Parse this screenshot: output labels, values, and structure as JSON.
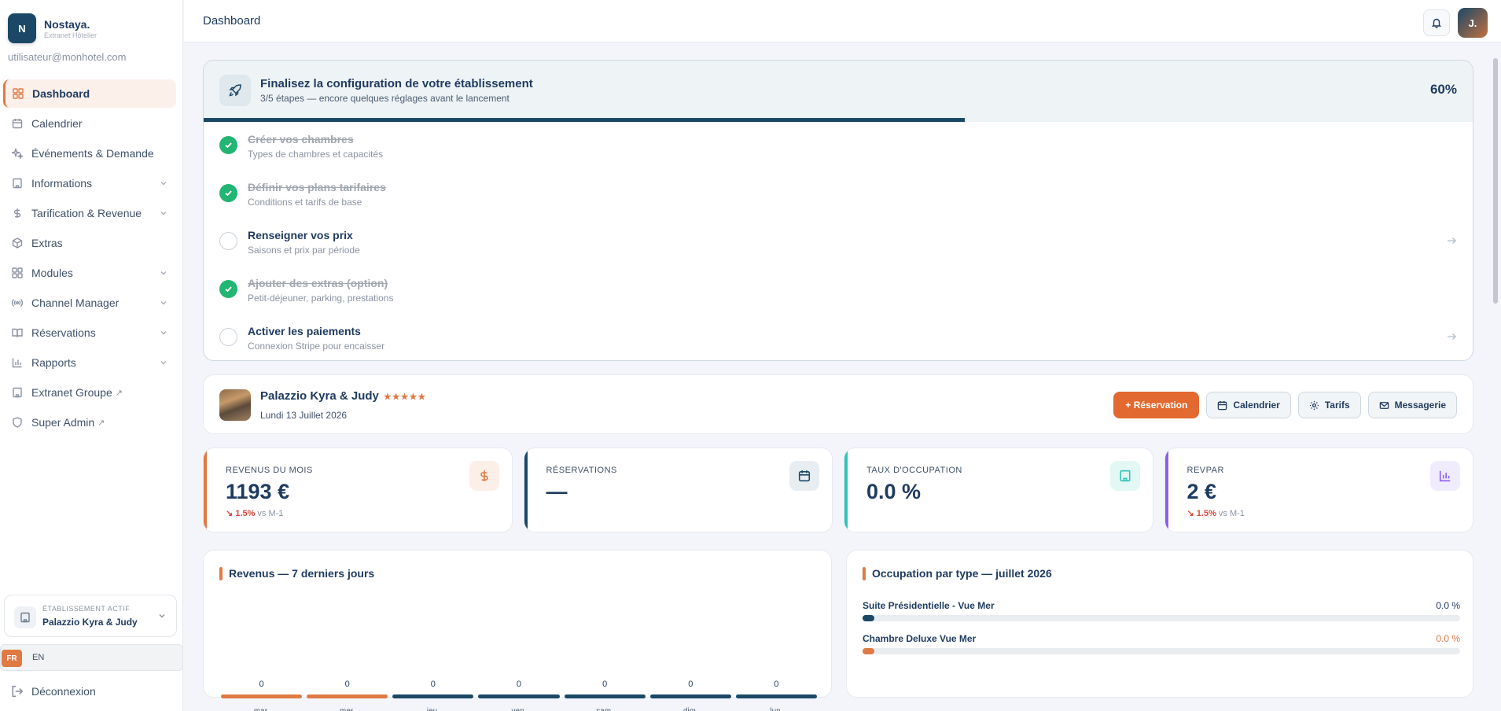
{
  "brand": {
    "logo_letter": "N",
    "name": "Nostaya.",
    "subtitle": "Extranet Hôtelier"
  },
  "user": {
    "email": "utilisateur@monhotel.com",
    "avatar_initial": "J."
  },
  "sidebar": {
    "items": [
      {
        "label": "Dashboard",
        "icon": "grid-icon",
        "active": true,
        "chevron": false
      },
      {
        "label": "Calendrier",
        "icon": "calendar-icon",
        "chevron": false
      },
      {
        "label": "Événements & Demande",
        "icon": "sparkle-icon",
        "chevron": false
      },
      {
        "label": "Informations",
        "icon": "building-icon",
        "chevron": true
      },
      {
        "label": "Tarification & Revenue",
        "icon": "dollar-icon",
        "chevron": true
      },
      {
        "label": "Extras",
        "icon": "package-icon",
        "chevron": false
      },
      {
        "label": "Modules",
        "icon": "grid-icon",
        "chevron": true
      },
      {
        "label": "Channel Manager",
        "icon": "broadcast-icon",
        "chevron": true
      },
      {
        "label": "Réservations",
        "icon": "book-icon",
        "chevron": true
      },
      {
        "label": "Rapports",
        "icon": "chart-icon",
        "chevron": true
      },
      {
        "label": "Extranet Groupe",
        "icon": "building-icon",
        "external": "↗"
      },
      {
        "label": "Super Admin",
        "icon": "shield-icon",
        "external": "↗"
      }
    ],
    "active_property": {
      "label": "ÉTABLISSEMENT ACTIF",
      "name": "Palazzio Kyra & Judy"
    },
    "languages": {
      "fr": "FR",
      "en": "EN"
    },
    "logout_label": "Déconnexion"
  },
  "header": {
    "title": "Dashboard"
  },
  "onboarding": {
    "title": "Finalisez la configuration de votre établissement",
    "subtitle": "3/5 étapes — encore quelques réglages avant le lancement",
    "percent_label": "60%",
    "progress": 0.6,
    "steps": [
      {
        "title": "Créer vos chambres",
        "subtitle": "Types de chambres et capacités",
        "done": true
      },
      {
        "title": "Définir vos plans tarifaires",
        "subtitle": "Conditions et tarifs de base",
        "done": true
      },
      {
        "title": "Renseigner vos prix",
        "subtitle": "Saisons et prix par période",
        "done": false
      },
      {
        "title": "Ajouter des extras (option)",
        "subtitle": "Petit-déjeuner, parking, prestations",
        "done": true
      },
      {
        "title": "Activer les paiements",
        "subtitle": "Connexion Stripe pour encaisser",
        "done": false
      }
    ]
  },
  "property": {
    "name": "Palazzio Kyra & Judy",
    "stars": "★★★★★",
    "date": "Lundi 13 Juillet 2026",
    "buttons": {
      "reservation": "+ Réservation",
      "calendar": "Calendrier",
      "tariffs": "Tarifs",
      "messaging": "Messagerie"
    }
  },
  "kpis": [
    {
      "label": "REVENUS DU MOIS",
      "value": "1193 €",
      "trend_arrow": "↘",
      "trend_value": "1.5%",
      "trend_suffix": "vs M-1",
      "accent": "#e07a43",
      "icon": "dollar-icon",
      "icon_bg": "#fcefe8",
      "icon_color": "#e07a43"
    },
    {
      "label": "RÉSERVATIONS",
      "value": "—",
      "accent": "#1b4866",
      "icon": "calendar-icon",
      "icon_bg": "#e8edf2",
      "icon_color": "#1b4866"
    },
    {
      "label": "TAUX D'OCCUPATION",
      "value": "0.0 %",
      "accent": "#2ec4b6",
      "icon": "building-icon",
      "icon_bg": "#e3f7f5",
      "icon_color": "#2ec4b6"
    },
    {
      "label": "REVPAR",
      "value": "2 €",
      "trend_arrow": "↘",
      "trend_value": "1.5%",
      "trend_suffix": "vs M-1",
      "accent": "#8b5cf6",
      "icon": "chart-icon",
      "icon_bg": "#f1ecfd",
      "icon_color": "#8b5cf6"
    }
  ],
  "revenue_card": {
    "title": "Revenus — 7 derniers jours",
    "chart_data": {
      "type": "bar",
      "categories": [
        "mar.",
        "mer.",
        "jeu.",
        "ven.",
        "sam.",
        "dim.",
        "lun."
      ],
      "values": [
        0,
        0,
        0,
        0,
        0,
        0,
        0
      ],
      "colors": [
        "#e07a43",
        "#e07a43",
        "#1b4866",
        "#1b4866",
        "#1b4866",
        "#1b4866",
        "#1b4866"
      ]
    }
  },
  "occupancy_card": {
    "title": "Occupation par type — juillet 2026",
    "rows": [
      {
        "name": "Suite Présidentielle - Vue Mer",
        "value": "0.0 %",
        "fill": 0.02,
        "color": "#1b4866",
        "value_color": "#1e3a5f"
      },
      {
        "name": "Chambre Deluxe Vue Mer",
        "value": "0.0 %",
        "fill": 0.02,
        "color": "#e07a43",
        "value_color": "#e07a43"
      }
    ]
  }
}
